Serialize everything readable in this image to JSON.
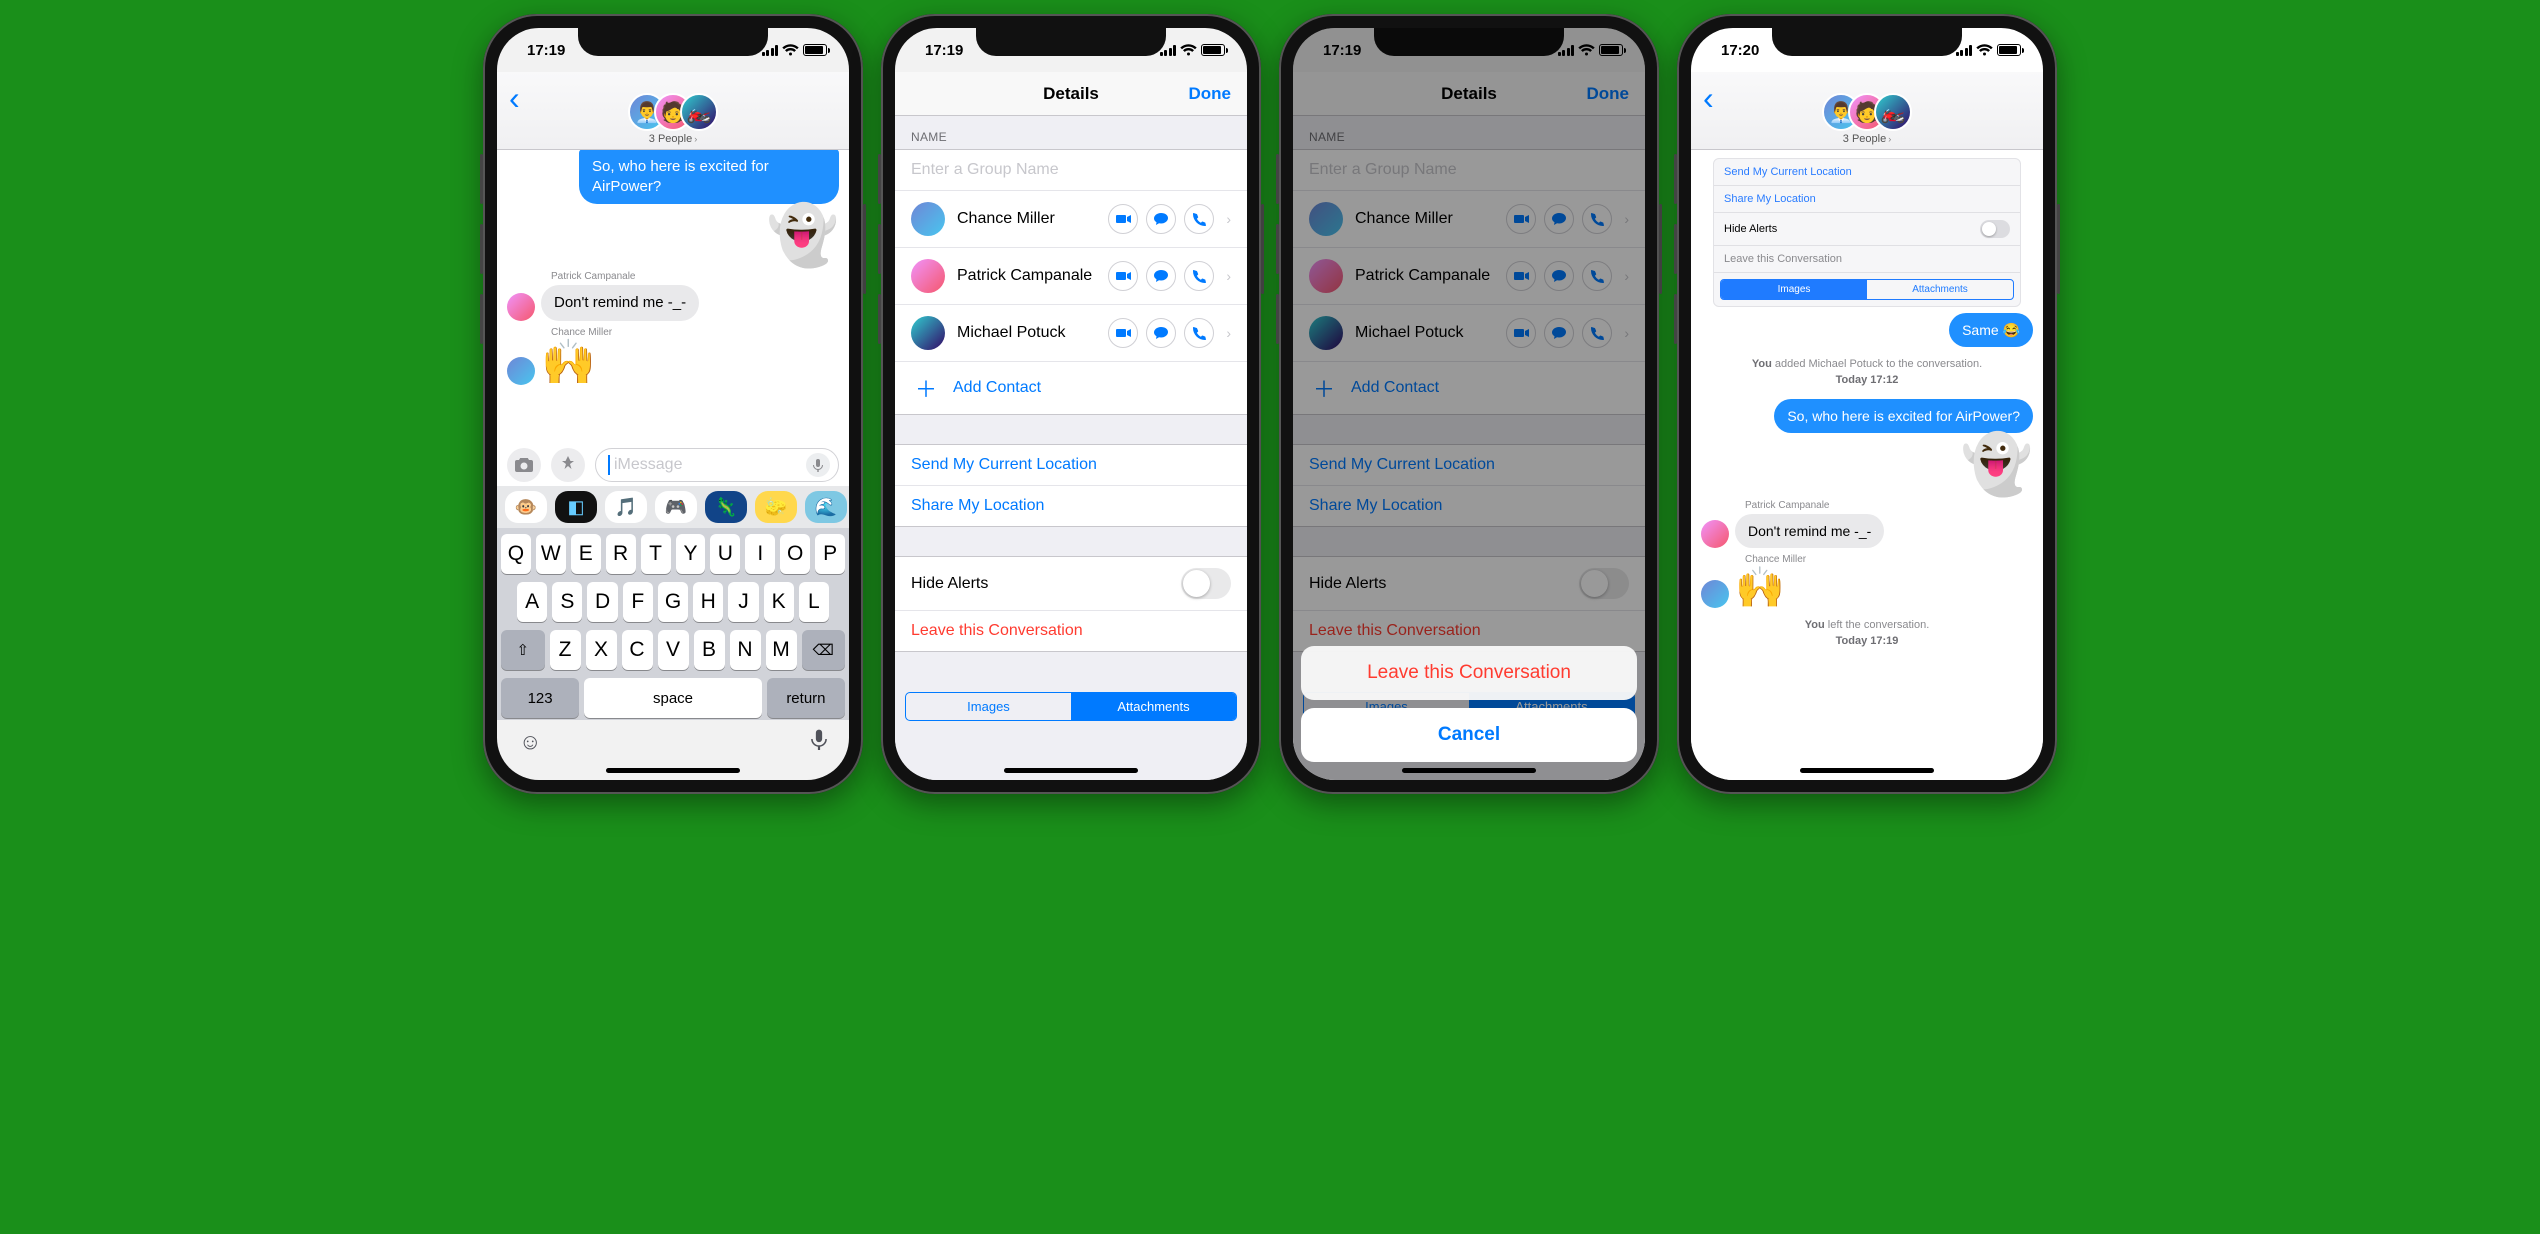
{
  "screens": {
    "s1": {
      "time": "17:19",
      "header": {
        "subtitle": "3 People"
      },
      "messages": {
        "outgoing_cut": "So, who here is excited for AirPower?",
        "ghost": "👻",
        "patrick_label": "Patrick Campanale",
        "patrick_text": "Don't remind me -_-",
        "chance_label": "Chance Miller",
        "chance_emoji": "🙌"
      },
      "compose": {
        "placeholder": "iMessage"
      },
      "keyboard": {
        "row1": [
          "Q",
          "W",
          "E",
          "R",
          "T",
          "Y",
          "U",
          "I",
          "O",
          "P"
        ],
        "row2": [
          "A",
          "S",
          "D",
          "F",
          "G",
          "H",
          "J",
          "K",
          "L"
        ],
        "row3_shift": "⇧",
        "row3": [
          "Z",
          "X",
          "C",
          "V",
          "B",
          "N",
          "M"
        ],
        "row3_del": "⌫",
        "num": "123",
        "space": "space",
        "return": "return"
      },
      "apps": [
        "🐵",
        "◧",
        "🎵",
        "🎮",
        "🦎",
        "🧽",
        "🌊"
      ]
    },
    "s2": {
      "time": "17:19",
      "title": "Details",
      "done": "Done",
      "name_header": "NAME",
      "name_placeholder": "Enter a Group Name",
      "contacts": [
        {
          "name": "Chance Miller"
        },
        {
          "name": "Patrick Campanale"
        },
        {
          "name": "Michael Potuck"
        }
      ],
      "add_contact": "Add Contact",
      "send_loc": "Send My Current Location",
      "share_loc": "Share My Location",
      "hide_alerts": "Hide Alerts",
      "leave": "Leave this Conversation",
      "seg_images": "Images",
      "seg_attach": "Attachments"
    },
    "s3": {
      "sheet_leave": "Leave this Conversation",
      "sheet_cancel": "Cancel"
    },
    "s4": {
      "time": "17:20",
      "header": {
        "subtitle": "3 People"
      },
      "card": {
        "send_loc": "Send My Current Location",
        "share_loc": "Share My Location",
        "hide_alerts": "Hide Alerts",
        "leave": "Leave this Conversation",
        "images": "Images",
        "attach": "Attachments"
      },
      "msg_same": "Same 😂",
      "sys_added_pre": "You",
      "sys_added": " added Michael Potuck to the conversation.",
      "sys_added_time": "Today 17:12",
      "msg_air": "So, who here is excited for AirPower?",
      "ghost": "👻",
      "patrick_label": "Patrick Campanale",
      "patrick_text": "Don't remind me -_-",
      "chance_label": "Chance Miller",
      "chance_emoji": "🙌",
      "sys_left_pre": "You",
      "sys_left": " left the conversation.",
      "sys_left_time": "Today 17:19"
    }
  }
}
